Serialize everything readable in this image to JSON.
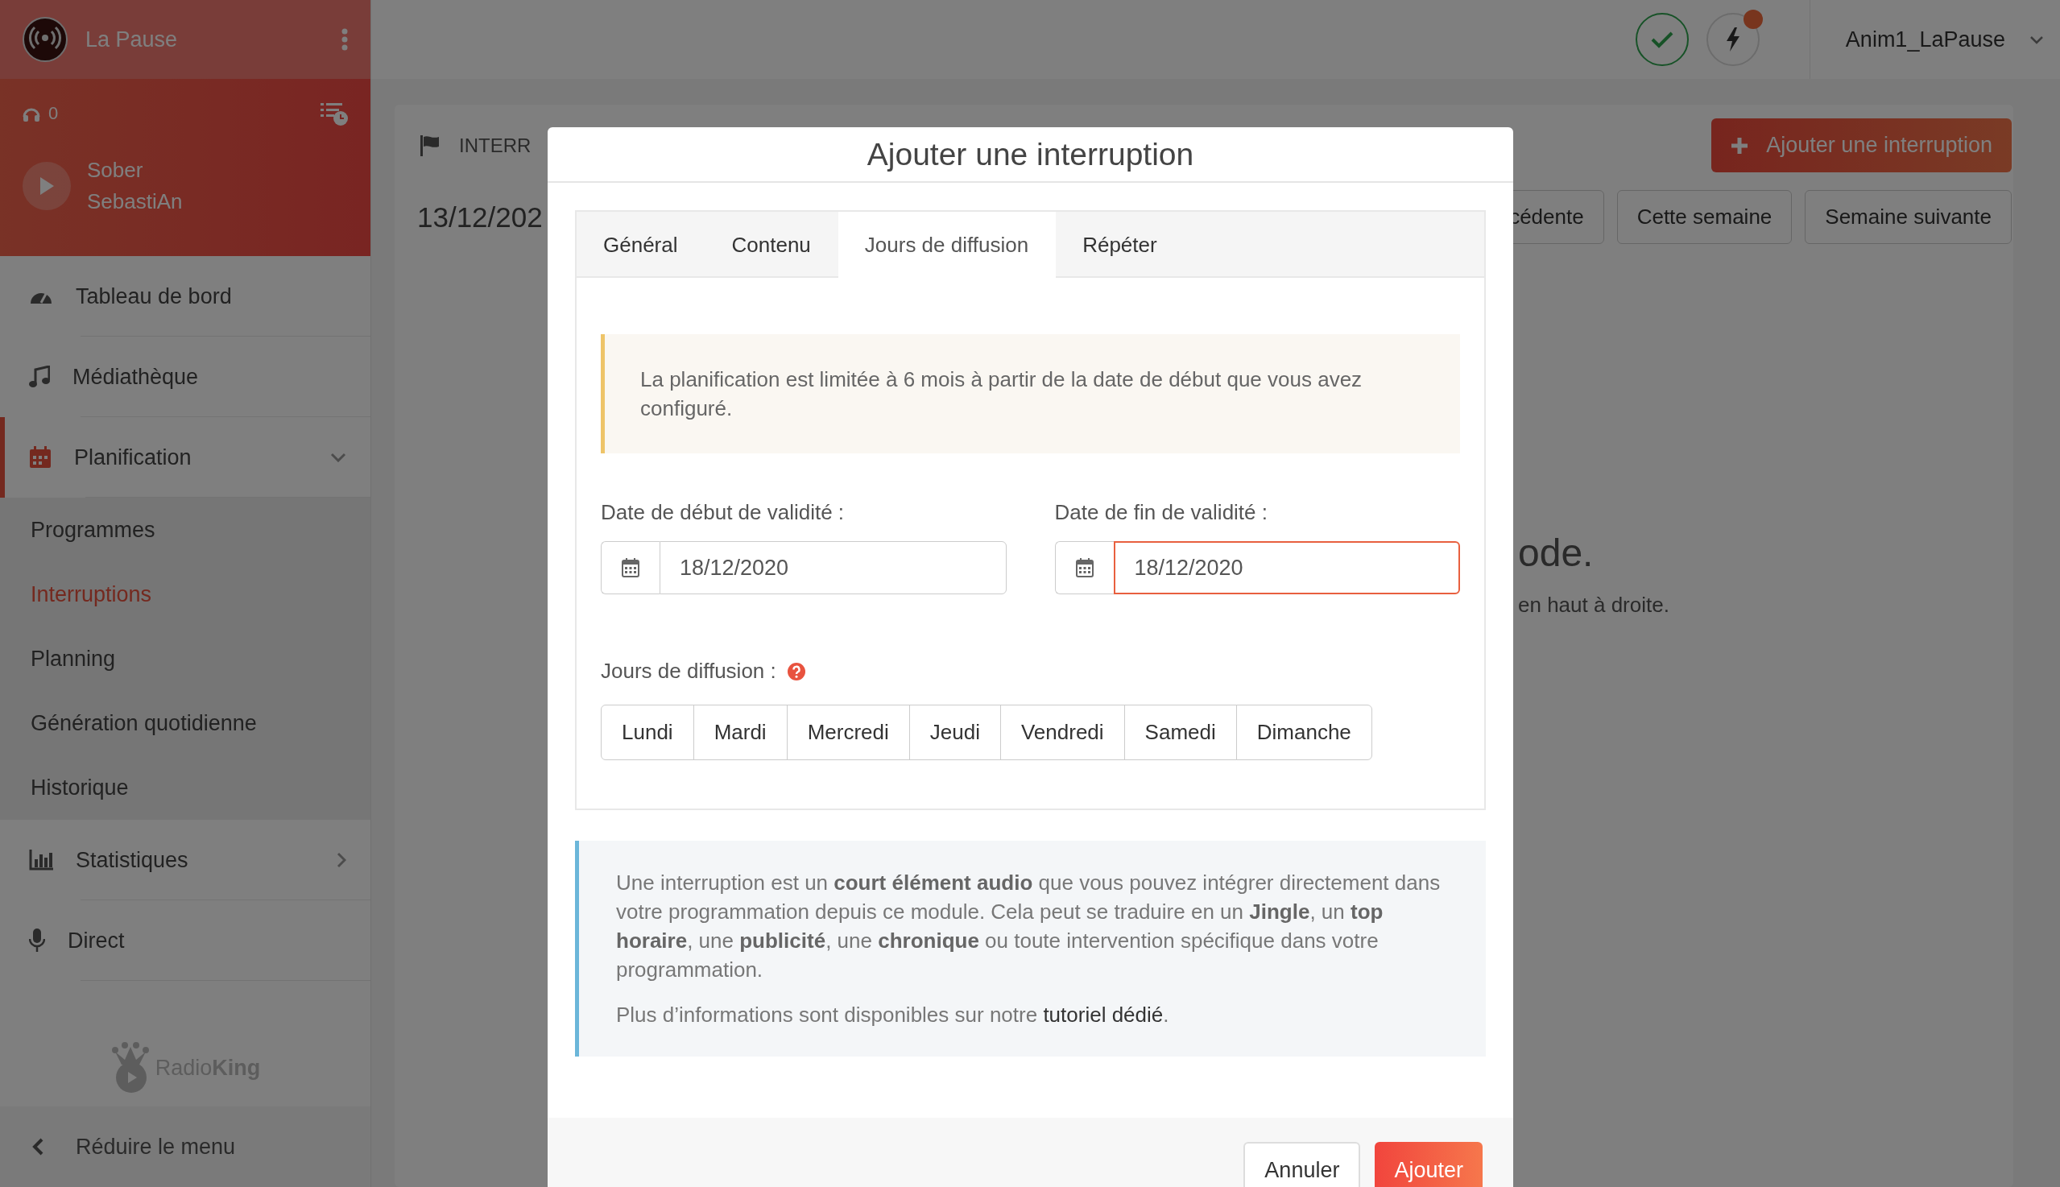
{
  "sidebar": {
    "station": "La Pause",
    "listeners": "0",
    "now_playing": {
      "title": "Sober",
      "artist": "SebastiAn"
    },
    "items": [
      {
        "label": "Tableau de bord",
        "selected": false
      },
      {
        "label": "Médiathèque",
        "selected": false
      },
      {
        "label": "Planification",
        "selected": true,
        "expanded": true,
        "children": [
          {
            "label": "Programmes",
            "selected": false
          },
          {
            "label": "Interruptions",
            "selected": true
          },
          {
            "label": "Planning",
            "selected": false
          },
          {
            "label": "Génération quotidienne",
            "selected": false
          },
          {
            "label": "Historique",
            "selected": false
          }
        ]
      },
      {
        "label": "Statistiques",
        "selected": false,
        "expanded": false
      },
      {
        "label": "Direct",
        "selected": false
      }
    ],
    "brand": "Radio**King**",
    "collapse": "Réduire le menu"
  },
  "topbar": {
    "notification": true,
    "user": "Anim1_LaPause"
  },
  "page": {
    "section": "INTERR",
    "add_button": "Ajouter une interruption",
    "date": "13/12/202",
    "week_buttons": [
      "cédente",
      "Cette semaine",
      "Semaine suivante"
    ],
    "empty_title": "ode.",
    "empty_hint": "en haut à droite."
  },
  "modal": {
    "title": "Ajouter une interruption",
    "tabs": [
      {
        "label": "Général",
        "selected": false
      },
      {
        "label": "Contenu",
        "selected": false
      },
      {
        "label": "Jours de diffusion",
        "selected": true
      },
      {
        "label": "Répéter",
        "selected": false
      }
    ],
    "notice": "La planification est limitée à 6 mois à partir de la date de début que vous avez configuré.",
    "fields": [
      {
        "label": "Date de début de validité :",
        "value": "18/12/2020",
        "focused": false
      },
      {
        "label": "Date de fin de validité :",
        "value": "18/12/2020",
        "focused": true
      }
    ],
    "days_label": "Jours de diffusion :",
    "days": [
      {
        "label": "Lundi",
        "selected": false
      },
      {
        "label": "Mardi",
        "selected": false
      },
      {
        "label": "Mercredi",
        "selected": false
      },
      {
        "label": "Jeudi",
        "selected": false
      },
      {
        "label": "Vendredi",
        "selected": false
      },
      {
        "label": "Samedi",
        "selected": false
      },
      {
        "label": "Dimanche",
        "selected": false
      }
    ],
    "info": "Une interruption est un **court élément audio** que vous pouvez intégrer directement dans votre programmation depuis ce module. Cela peut se traduire en un **Jingle**, un **top horaire**, une **publicité**, une **chronique** ou toute intervention spécifique dans votre programmation.",
    "more": "Plus d’informations sont disponibles sur notre",
    "more_link": "tutoriel dédié",
    "more_end": ".",
    "buttons": [
      {
        "label": "Annuler",
        "kind": "secondary"
      },
      {
        "label": "Ajouter",
        "kind": "primary"
      }
    ]
  }
}
